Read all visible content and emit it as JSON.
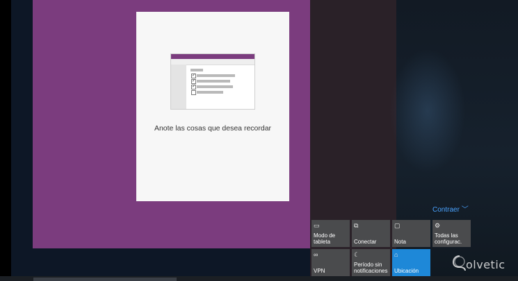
{
  "onenote_card": {
    "caption": "Anote las cosas que desea recordar"
  },
  "action_center": {
    "collapse_label": "Contraer",
    "tiles": [
      {
        "label": "Modo de\ntableta",
        "icon": "tablet-mode-icon",
        "active": false
      },
      {
        "label": "Conectar",
        "icon": "connect-icon",
        "active": false
      },
      {
        "label": "Nota",
        "icon": "note-icon",
        "active": false
      },
      {
        "label": "Todas las\nconfigurac.",
        "icon": "settings-gear-icon",
        "active": false
      },
      {
        "label": "VPN",
        "icon": "vpn-icon",
        "active": false
      },
      {
        "label": "Período sin\nnotificaciones",
        "icon": "quiet-hours-moon-icon",
        "active": false
      },
      {
        "label": "Ubicación",
        "icon": "location-icon",
        "active": true
      }
    ],
    "active_color": "#1e88d8",
    "tile_color": "#4a4b4d"
  },
  "watermark": {
    "text": "olvetic"
  }
}
